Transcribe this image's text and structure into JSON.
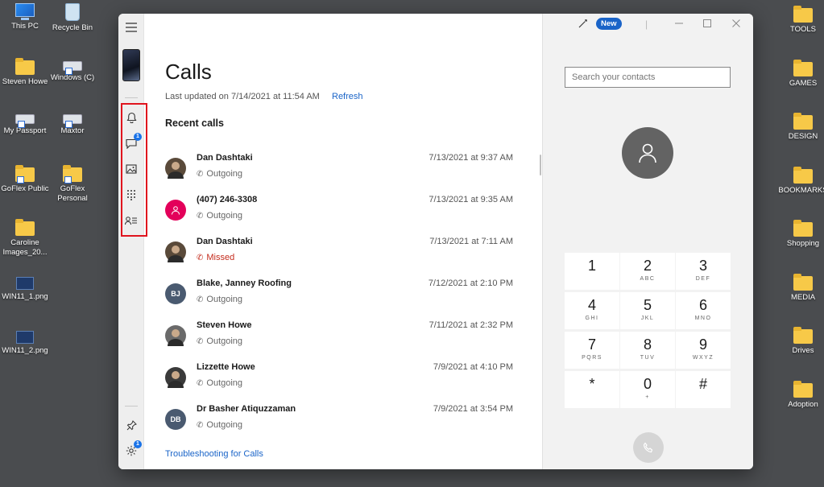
{
  "desktop": {
    "left_icons": [
      {
        "label": "This PC",
        "icon": "monitor-icon"
      },
      {
        "label": "Recycle Bin",
        "icon": "recycle-bin-icon"
      },
      {
        "label": "Steven Howe",
        "icon": "folder-icon"
      },
      {
        "label": "Windows (C)",
        "icon": "drive-shortcut-icon"
      },
      {
        "label": "My Passport",
        "icon": "drive-shortcut-icon"
      },
      {
        "label": "Maxtor",
        "icon": "drive-shortcut-icon"
      },
      {
        "label": "GoFlex Public",
        "icon": "folder-shortcut-icon"
      },
      {
        "label": "GoFlex Personal",
        "icon": "folder-shortcut-icon"
      },
      {
        "label": "Caroline Images_20...",
        "icon": "folder-icon"
      },
      {
        "label": "WIN11_1.png",
        "icon": "image-file-icon"
      },
      {
        "label": "WIN11_2.png",
        "icon": "image-file-icon"
      }
    ],
    "right_icons": [
      {
        "label": "TOOLS"
      },
      {
        "label": "GAMES"
      },
      {
        "label": "DESIGN"
      },
      {
        "label": "BOOKMARKS"
      },
      {
        "label": "Shopping"
      },
      {
        "label": "MEDIA"
      },
      {
        "label": "Drives"
      },
      {
        "label": "Adoption"
      }
    ]
  },
  "rail": {
    "messages_badge": "1",
    "settings_badge": "1"
  },
  "calls": {
    "title": "Calls",
    "updated": "Last updated on 7/14/2021 at 11:54 AM",
    "refresh_label": "Refresh",
    "section_title": "Recent calls",
    "items": [
      {
        "name": "Dan Dashtaki",
        "status": "Outgoing",
        "time": "7/13/2021 at 9:37 AM",
        "initials": "",
        "avatar_color": "#5a4a3a",
        "missed": false
      },
      {
        "name": "(407) 246-3308",
        "status": "Outgoing",
        "time": "7/13/2021 at 9:35 AM",
        "initials": "",
        "avatar_color": "#e3005a",
        "missed": false
      },
      {
        "name": "Dan Dashtaki",
        "status": "Missed",
        "time": "7/13/2021 at 7:11 AM",
        "initials": "",
        "avatar_color": "#5a4a3a",
        "missed": true
      },
      {
        "name": "Blake, Janney Roofing",
        "status": "Outgoing",
        "time": "7/12/2021 at 2:10 PM",
        "initials": "BJ",
        "avatar_color": "#4a5a70",
        "missed": false
      },
      {
        "name": "Steven Howe",
        "status": "Outgoing",
        "time": "7/11/2021 at 2:32 PM",
        "initials": "",
        "avatar_color": "#6a6a6a",
        "missed": false
      },
      {
        "name": "Lizzette Howe",
        "status": "Outgoing",
        "time": "7/9/2021 at 4:10 PM",
        "initials": "",
        "avatar_color": "#3a3a3a",
        "missed": false
      },
      {
        "name": "Dr Basher Atiquzzaman",
        "status": "Outgoing",
        "time": "7/9/2021 at 3:54 PM",
        "initials": "DB",
        "avatar_color": "#4a5a70",
        "missed": false
      }
    ],
    "troubleshooting_label": "Troubleshooting for Calls"
  },
  "titlebar": {
    "new_label": "New"
  },
  "dialer": {
    "search_placeholder": "Search your contacts",
    "keys": [
      {
        "digit": "1",
        "letters": ""
      },
      {
        "digit": "2",
        "letters": "ABC"
      },
      {
        "digit": "3",
        "letters": "DEF"
      },
      {
        "digit": "4",
        "letters": "GHI"
      },
      {
        "digit": "5",
        "letters": "JKL"
      },
      {
        "digit": "6",
        "letters": "MNO"
      },
      {
        "digit": "7",
        "letters": "PQRS"
      },
      {
        "digit": "8",
        "letters": "TUV"
      },
      {
        "digit": "9",
        "letters": "WXYZ"
      },
      {
        "digit": "*",
        "letters": ""
      },
      {
        "digit": "0",
        "letters": "+"
      },
      {
        "digit": "#",
        "letters": ""
      }
    ]
  },
  "colors": {
    "accent": "#1a64c8",
    "highlight_box": "#e0141e",
    "missed": "#c42b1c"
  }
}
